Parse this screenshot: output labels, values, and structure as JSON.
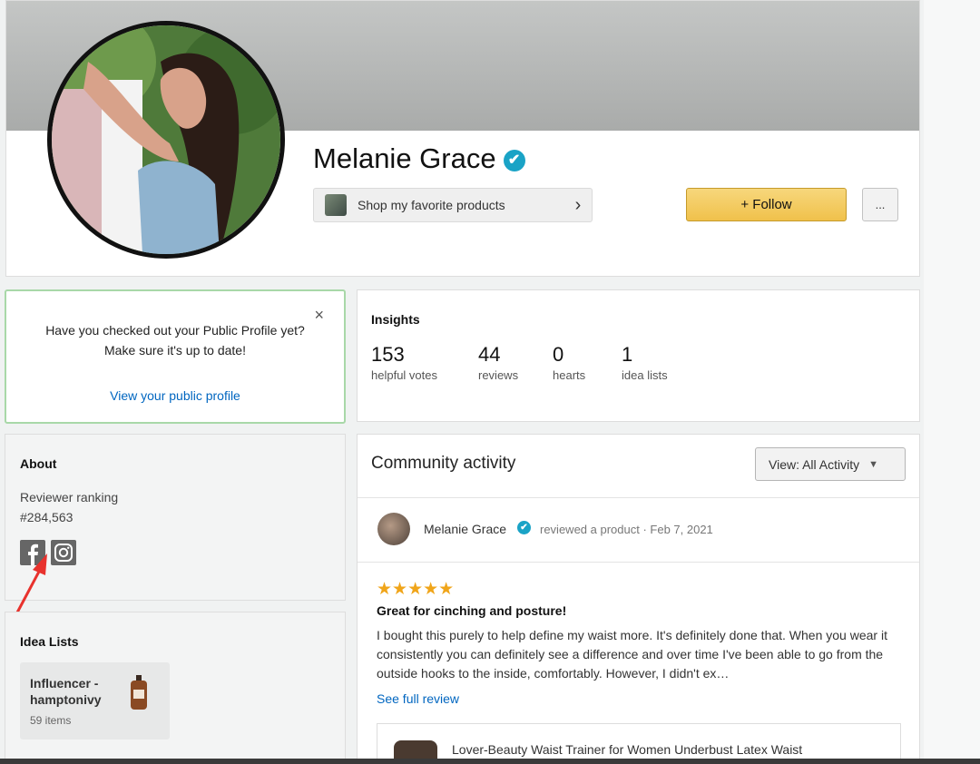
{
  "profile": {
    "name": "Melanie Grace",
    "verified_glyph": "✔",
    "shop_button_label": "Shop my favorite products",
    "shop_chevron": "›",
    "follow_label": "+ Follow",
    "more_label": "..."
  },
  "notice": {
    "close_glyph": "×",
    "line1": "Have you checked out your Public Profile yet?",
    "line2": "Make sure it's up to date!",
    "link": "View your public profile"
  },
  "insights": {
    "title": "Insights",
    "stats": [
      {
        "value": "153",
        "label": "helpful votes"
      },
      {
        "value": "44",
        "label": "reviews"
      },
      {
        "value": "0",
        "label": "hearts"
      },
      {
        "value": "1",
        "label": "idea lists"
      }
    ]
  },
  "about": {
    "title": "About",
    "ranking_label": "Reviewer ranking",
    "ranking_value": "#284,563",
    "social_icons": [
      "facebook-icon",
      "instagram-icon"
    ]
  },
  "idea_lists": {
    "title": "Idea Lists",
    "items": [
      {
        "name": "Influencer - hamptonivy",
        "count": "59 items"
      }
    ]
  },
  "community": {
    "title": "Community activity",
    "view_select": "View: All Activity",
    "activity": {
      "author": "Melanie Grace",
      "verified_glyph": "✔",
      "meta": "reviewed a product · Feb 7, 2021",
      "stars": "★★★★★",
      "review_title": "Great for cinching and posture!",
      "review_body": "I bought this purely to help define my waist more. It's definitely done that. When you wear it consistently you can definitely see a difference and over time I've been able to go from the outside hooks to the inside, comfortably. However, I didn't ex…",
      "see_full": "See full review",
      "product_title": "Lover-Beauty Waist Trainer for Women Underbust Latex Waist"
    }
  },
  "colors": {
    "accent_link": "#0066c0",
    "follow_button": "#f0c14b",
    "verified_badge": "#1aa3c6",
    "star": "#f0a51a",
    "notice_border": "#a8d8a8",
    "annotation_arrow": "#e8322d"
  }
}
